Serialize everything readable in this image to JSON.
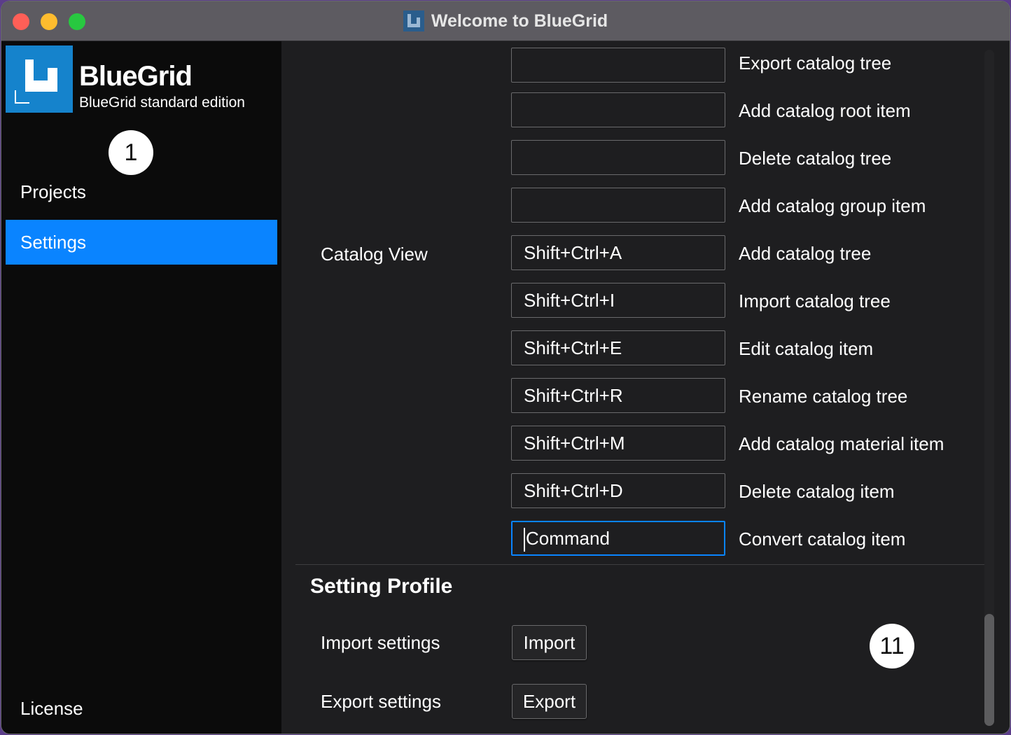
{
  "window": {
    "title": "Welcome to BlueGrid"
  },
  "sidebar": {
    "brand_name": "BlueGrid",
    "brand_subtitle": "BlueGrid standard edition",
    "nav": [
      "Projects",
      "Settings"
    ],
    "active": "Settings",
    "footer_item": "License"
  },
  "badges": {
    "sidebar": "1",
    "content": "11"
  },
  "catalog_view": {
    "group_label": "Catalog View",
    "shortcuts": [
      {
        "key": "",
        "action": "Export catalog tree"
      },
      {
        "key": "",
        "action": "Add catalog root item"
      },
      {
        "key": "",
        "action": "Delete catalog tree"
      },
      {
        "key": "",
        "action": "Add catalog group item"
      },
      {
        "key": "Shift+Ctrl+A",
        "action": "Add catalog tree"
      },
      {
        "key": "Shift+Ctrl+I",
        "action": "Import catalog tree"
      },
      {
        "key": "Shift+Ctrl+E",
        "action": "Edit catalog item"
      },
      {
        "key": "Shift+Ctrl+R",
        "action": "Rename catalog tree"
      },
      {
        "key": "Shift+Ctrl+M",
        "action": "Add catalog material item"
      },
      {
        "key": "Shift+Ctrl+D",
        "action": "Delete catalog item"
      },
      {
        "key": "Command",
        "action": "Convert catalog item"
      }
    ]
  },
  "setting_profile": {
    "title": "Setting Profile",
    "import_label": "Import settings",
    "import_button": "Import",
    "export_label": "Export settings",
    "export_button": "Export"
  },
  "colors": {
    "accent": "#0a84ff",
    "logo_blue": "#1583cc",
    "sidebar_bg": "#0b0b0b",
    "content_bg": "#1e1e20"
  }
}
